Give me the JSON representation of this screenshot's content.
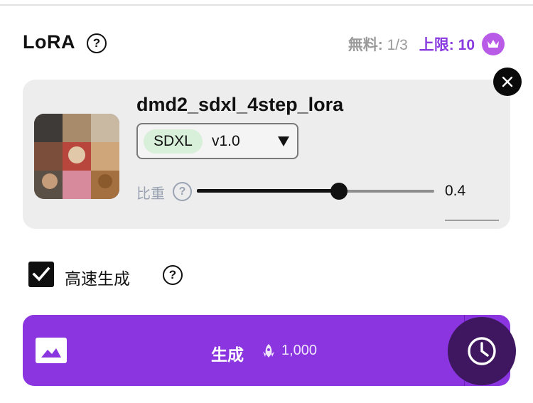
{
  "header": {
    "title": "LoRA",
    "free_label": "無料:",
    "free_value": "1/3",
    "limit_label": "上限:",
    "limit_value": "10"
  },
  "lora_card": {
    "model_name": "dmd2_sdxl_4step_lora",
    "base_model_chip": "SDXL",
    "version": "v1.0",
    "weight_label": "比重",
    "weight_value": "0.4",
    "weight_fraction": 0.6
  },
  "options": {
    "fast_generation_label": "高速生成",
    "fast_generation_checked": true
  },
  "generate_button": {
    "label": "生成",
    "cost": "1,000"
  },
  "icons": {
    "help": "question-circle-icon",
    "crown": "crown-icon",
    "close": "close-icon",
    "dropdown": "caret-down-icon",
    "image": "image-icon",
    "coin": "rocket-coin-icon",
    "history": "clock-icon"
  },
  "colors": {
    "accent": "#8a35e0",
    "chip": "#d8efd9",
    "card": "#ededed",
    "history": "#3e1760"
  }
}
